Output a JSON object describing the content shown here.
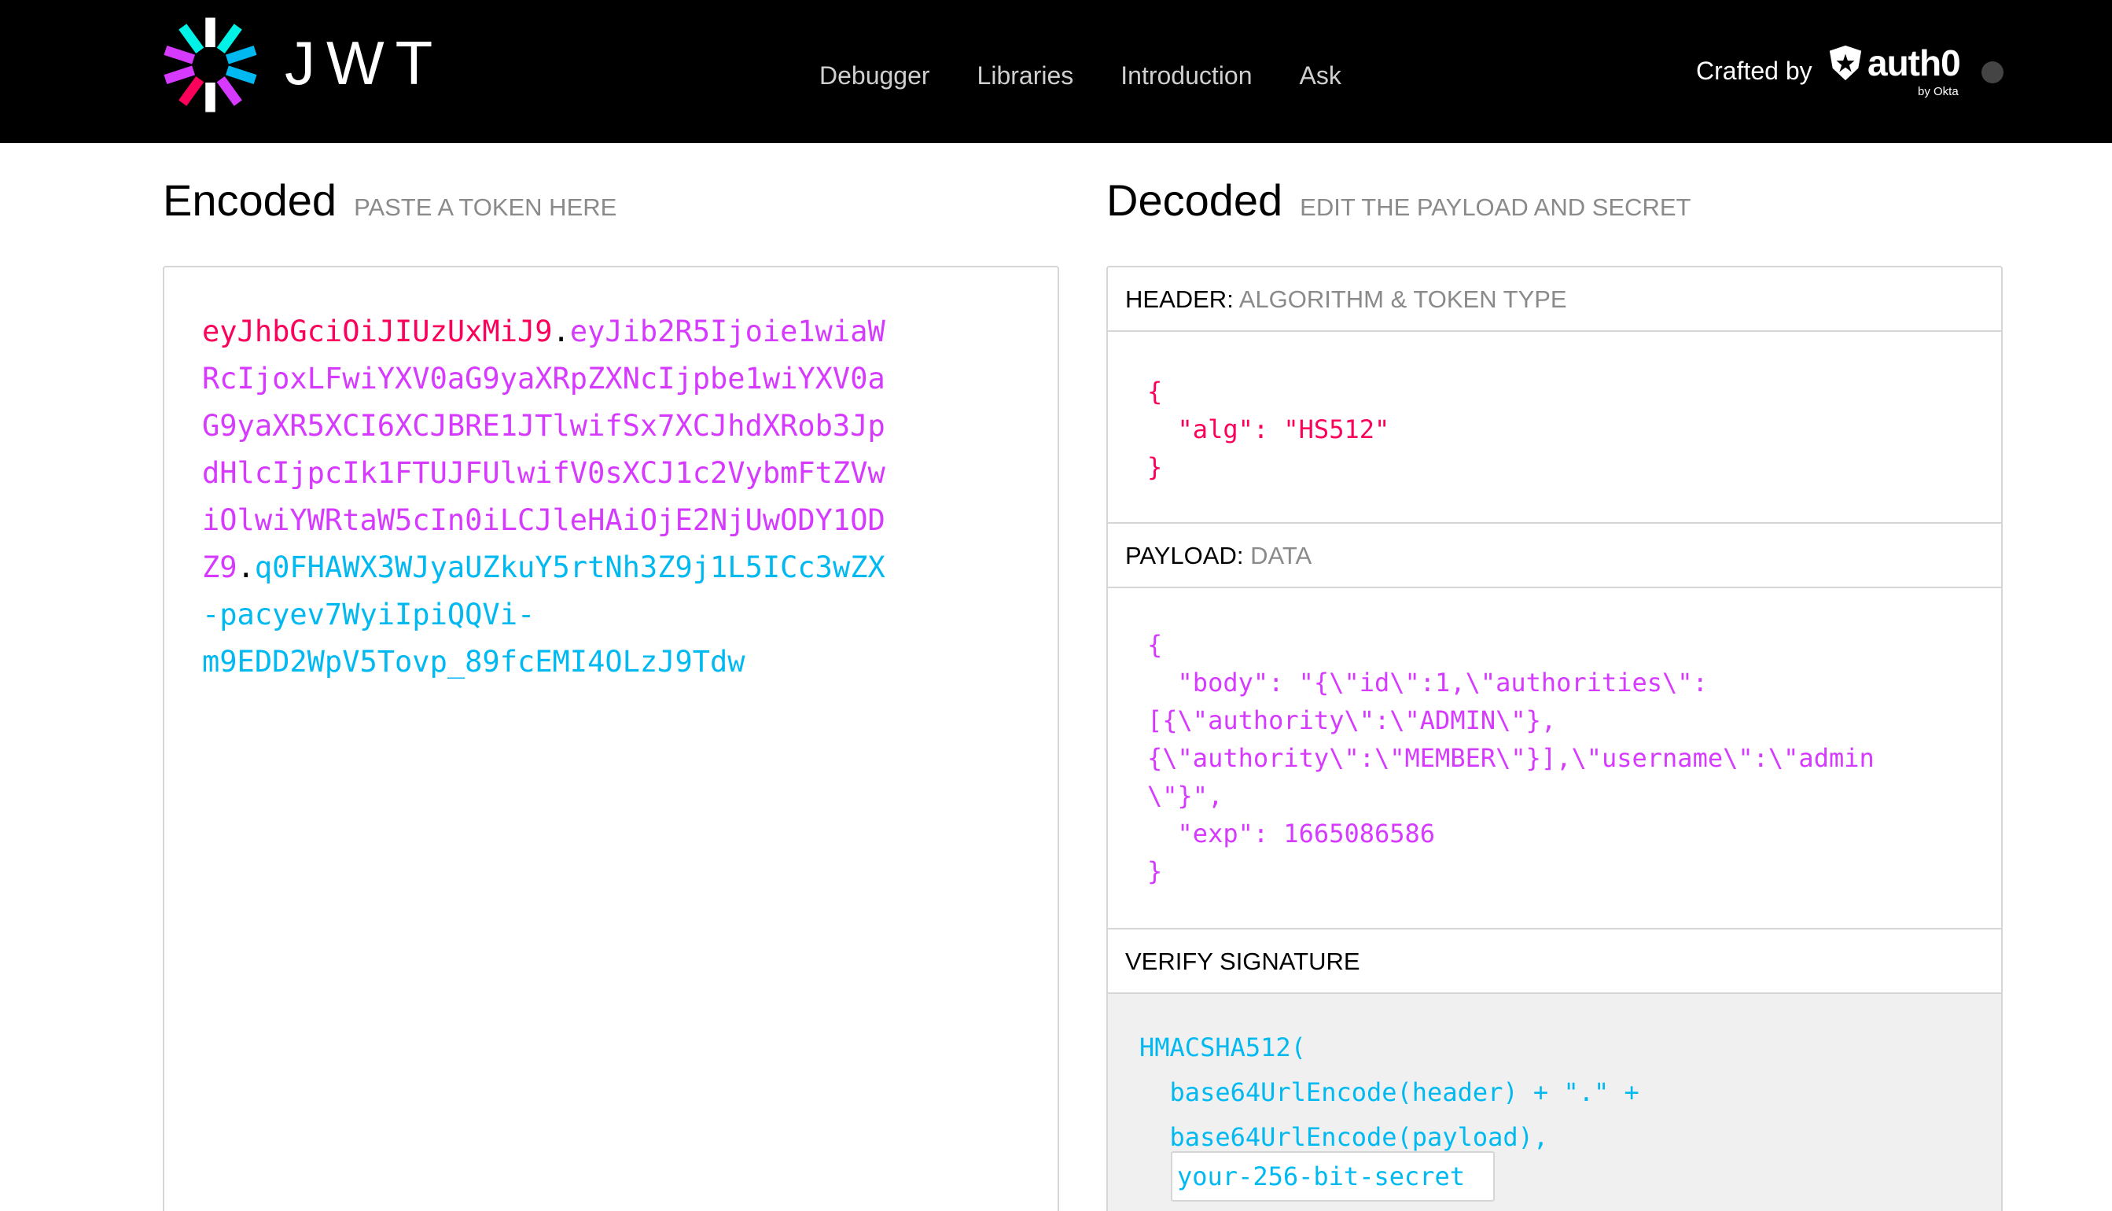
{
  "header": {
    "logo_text": "JWT",
    "nav": [
      "Debugger",
      "Libraries",
      "Introduction",
      "Ask"
    ],
    "crafted_by": "Crafted by",
    "brand": "auth0",
    "brand_sub": "by Okta"
  },
  "encoded": {
    "title": "Encoded",
    "subtitle": "PASTE A TOKEN HERE",
    "lines": [
      [
        {
          "t": "h",
          "v": "eyJhbGciOiJIUzUxMiJ9"
        },
        {
          "t": "d",
          "v": "."
        },
        {
          "t": "p",
          "v": "eyJib2R5Ijoie1wiaW"
        }
      ],
      [
        {
          "t": "p",
          "v": "RcIjoxLFwiYXV0aG9yaXRpZXNcIjpbe1wiYXV0a"
        }
      ],
      [
        {
          "t": "p",
          "v": "G9yaXR5XCI6XCJBRE1JTlwifSx7XCJhdXRob3Jp"
        }
      ],
      [
        {
          "t": "p",
          "v": "dHlcIjpcIk1FTUJFUlwifV0sXCJ1c2VybmFtZVw"
        }
      ],
      [
        {
          "t": "p",
          "v": "iOlwiYWRtaW5cIn0iLCJleHAiOjE2NjUwODY1OD"
        }
      ],
      [
        {
          "t": "p",
          "v": "Z9"
        },
        {
          "t": "d",
          "v": "."
        },
        {
          "t": "s",
          "v": "q0FHAWX3WJyaUZkuY5rtNh3Z9j1L5ICc3wZX"
        }
      ],
      [
        {
          "t": "s",
          "v": "-pacyev7WyiIpiQQVi-"
        }
      ],
      [
        {
          "t": "s",
          "v": "m9EDD2WpV5Tovp_89fcEMI4OLzJ9Tdw"
        }
      ]
    ]
  },
  "decoded": {
    "title": "Decoded",
    "subtitle": "EDIT THE PAYLOAD AND SECRET",
    "header_label": "HEADER:",
    "header_sub": "ALGORITHM & TOKEN TYPE",
    "header_json": "{\n  \"alg\": \"HS512\"\n}",
    "payload_label": "PAYLOAD:",
    "payload_sub": "DATA",
    "payload_json": "{\n  \"body\": \"{\\\"id\\\":1,\\\"authorities\\\":\n[{\\\"authority\\\":\\\"ADMIN\\\"},\n{\\\"authority\\\":\\\"MEMBER\\\"}],\\\"username\\\":\\\"admin\n\\\"}\",\n  \"exp\": 1665086586\n}",
    "verify_label": "VERIFY SIGNATURE",
    "verify_code": "HMACSHA512(\n  base64UrlEncode(header) + \".\" +\n  base64UrlEncode(payload),",
    "secret_value": "your-256-bit-secret"
  },
  "colors": {
    "header_part": "#fb015b",
    "payload_part": "#d63aff",
    "signature_part": "#00b9f1"
  }
}
